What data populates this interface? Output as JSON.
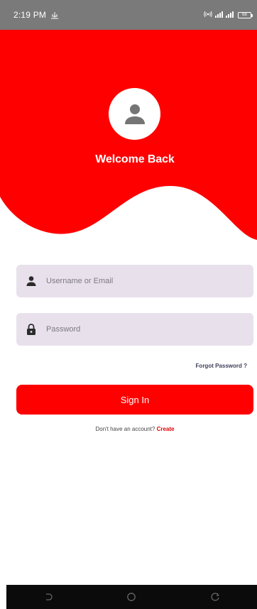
{
  "status_bar": {
    "time": "2:19 PM",
    "battery": "68"
  },
  "header": {
    "title": "Welcome Back"
  },
  "form": {
    "username_placeholder": "Username or Email",
    "password_placeholder": "Password",
    "forgot_label": "Forgot Password ?",
    "signin_label": "Sign In",
    "signup_prompt": "Don't have an account?",
    "create_label": "Create"
  },
  "icons": {
    "usb": "usb-icon",
    "hotspot": "hotspot-icon",
    "signal": "signal-icon",
    "battery": "battery-icon",
    "avatar": "person-icon",
    "username": "person-icon",
    "password": "lock-icon",
    "nav_back": "back-icon",
    "nav_home": "home-icon",
    "nav_recents": "recents-icon"
  },
  "colors": {
    "brand_red": "#ff0000",
    "status_bar": "#7a7a7a",
    "input_bg": "#e8e1ec",
    "link_dark": "#3e3e5a",
    "create_red": "#e00000",
    "nav_bar": "#0b0b0b"
  }
}
